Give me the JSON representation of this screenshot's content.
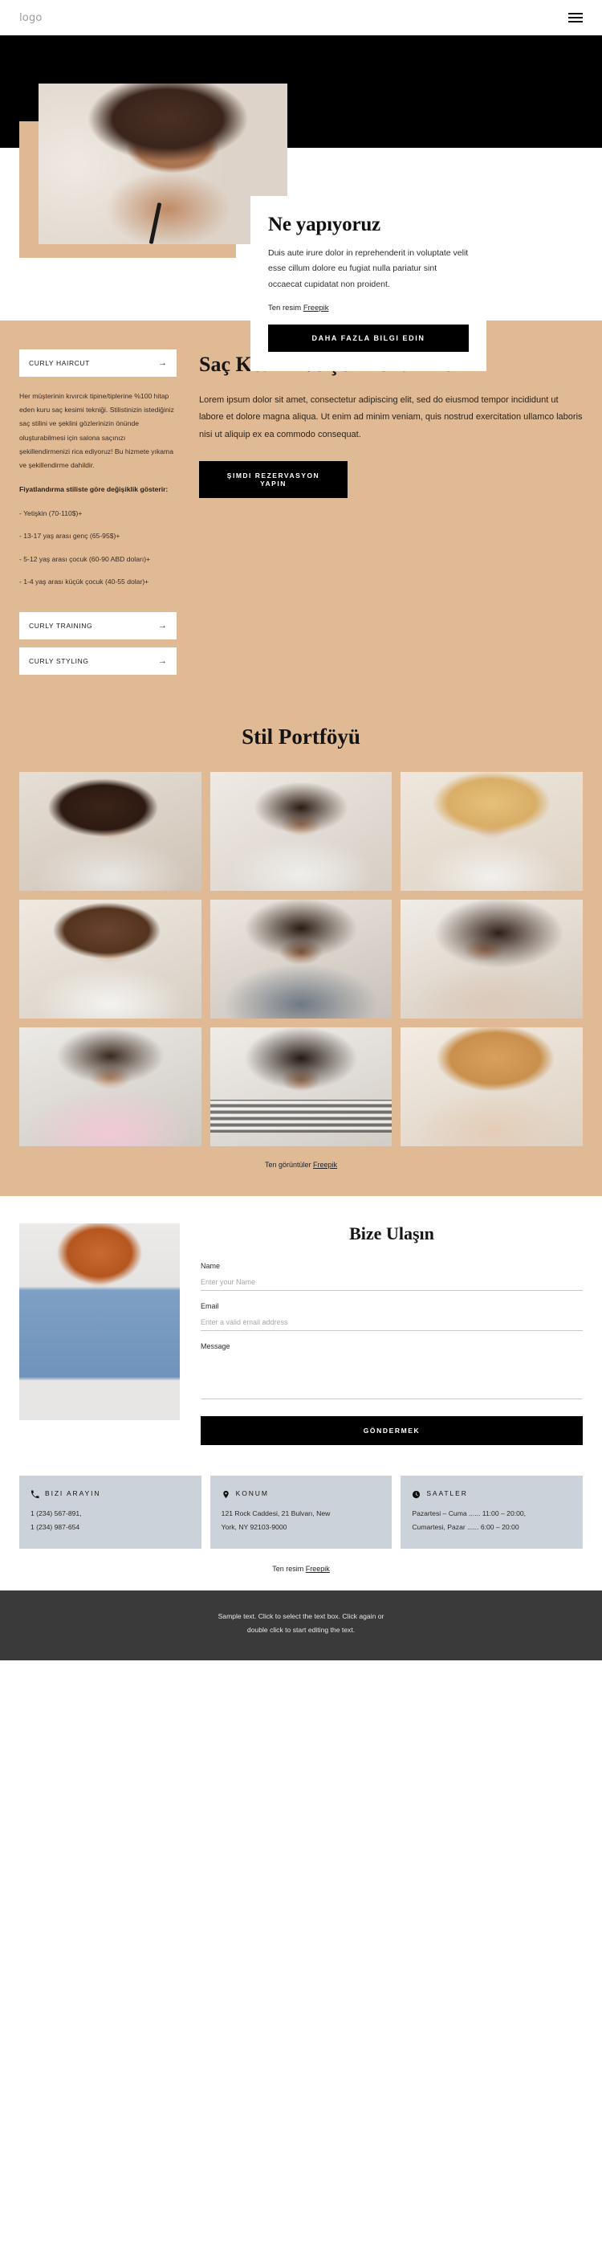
{
  "header": {
    "logo": "logo",
    "menu_icon": "hamburger-menu-icon"
  },
  "hero": {
    "card": {
      "title": "Ne yapıyoruz",
      "body": "Duis aute irure dolor in reprehenderit in voluptate velit esse cillum dolore eu fugiat nulla pariatur sint occaecat cupidatat non proident.",
      "credit_prefix": "Ten resim ",
      "credit_link": "Freepik",
      "button": "DAHA FAZLA BILGI EDIN"
    }
  },
  "services": {
    "accordion": [
      {
        "label": "CURLY HAIRCUT",
        "arrow": "→",
        "open": true
      },
      {
        "label": "CURLY TRAINING",
        "arrow": "→",
        "open": false
      },
      {
        "label": "CURLY STYLING",
        "arrow": "→",
        "open": false
      }
    ],
    "panel_body": "Her müşterinin kıvırcık tipine/tiplerine %100 hitap eden kuru saç kesimi tekniği. Stilistinizin istediğiniz saç stilini ve şeklini gözlerinizin önünde oluşturabilmesi için salona saçınızı şekillendirmenizi rica ediyoruz! Bu hizmete yıkama ve şekillendirme dahildir.",
    "pricing_heading": "Fiyatlandırma stiliste göre değişiklik gösterir:",
    "pricing": [
      "- Yetişkin (70-110$)+",
      "- 13-17 yaş arası genç (65-95$)+",
      "- 5-12 yaş arası çocuk (60-90 ABD doları)+",
      "- 1-4 yaş arası küçük çocuk (40-55 dolar)+"
    ],
    "title": "Saç Kesimi ve Şekillendirme",
    "body": "Lorem ipsum dolor sit amet, consectetur adipiscing elit, sed do eiusmod tempor incididunt ut labore et dolore magna aliqua. Ut enim ad minim veniam, quis nostrud exercitation ullamco laboris nisi ut aliquip ex ea commodo consequat.",
    "button": "ŞIMDI REZERVASYON YAPIN"
  },
  "portfolio": {
    "title": "Stil Portföyü",
    "items": [
      {
        "name": "gallery-photo-1",
        "style": "p1"
      },
      {
        "name": "gallery-photo-2",
        "style": "p2"
      },
      {
        "name": "gallery-photo-3",
        "style": "p3"
      },
      {
        "name": "gallery-photo-4",
        "style": "p4"
      },
      {
        "name": "gallery-photo-5",
        "style": "p5"
      },
      {
        "name": "gallery-photo-6",
        "style": "p6"
      },
      {
        "name": "gallery-photo-7",
        "style": "p7"
      },
      {
        "name": "gallery-photo-8",
        "style": "p8"
      },
      {
        "name": "gallery-photo-9",
        "style": "p9"
      }
    ],
    "credit_prefix": "Ten görüntüler ",
    "credit_link": "Freepik"
  },
  "contact": {
    "title": "Bize Ulaşın",
    "fields": {
      "name_label": "Name",
      "name_placeholder": "Enter your Name",
      "email_label": "Email",
      "email_placeholder": "Enter a valid email address",
      "message_label": "Message",
      "message_placeholder": ""
    },
    "button": "GÖNDERMEK"
  },
  "info_cards": [
    {
      "icon": "phone-icon",
      "title": "BIZI ARAYIN",
      "lines": [
        "1 (234) 567-891,",
        "1 (234) 987-654"
      ]
    },
    {
      "icon": "location-pin-icon",
      "title": "KONUM",
      "lines": [
        "121 Rock Caddesi, 21 Bulvarı, New",
        "York, NY 92103-9000"
      ]
    },
    {
      "icon": "clock-icon",
      "title": "SAATLER",
      "lines": [
        "Pazartesi – Cuma ...... 11:00 – 20:00,",
        "Cumartesi, Pazar ...... 6:00 – 20:00"
      ]
    }
  ],
  "bottom_credit": {
    "prefix": "Ten resim ",
    "link": "Freepik"
  },
  "footer": {
    "line1": "Sample text. Click to select the text box. Click again or",
    "line2": "double click to start editing the text."
  },
  "colors": {
    "tan": "#e0b995",
    "black": "#000000",
    "card_gray": "#ccd2d9",
    "footer_gray": "#3a3a3a"
  }
}
